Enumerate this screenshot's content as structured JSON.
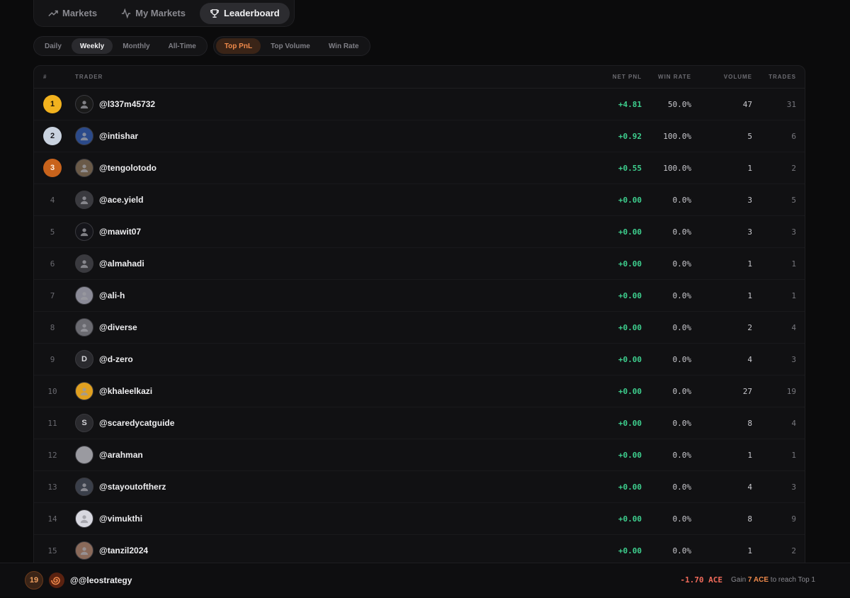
{
  "nav": {
    "tabs": [
      {
        "label": "Markets",
        "icon": "trend-icon"
      },
      {
        "label": "My Markets",
        "icon": "activity-icon"
      },
      {
        "label": "Leaderboard",
        "icon": "trophy-icon"
      }
    ],
    "active": "Leaderboard"
  },
  "period_filters": [
    "Daily",
    "Weekly",
    "Monthly",
    "All-Time"
  ],
  "period_active": "Weekly",
  "sort_filters": [
    "Top PnL",
    "Top Volume",
    "Win Rate"
  ],
  "sort_active": "Top PnL",
  "table": {
    "headers": {
      "rank": "#",
      "trader": "TRADER",
      "pnl": "NET PNL",
      "win": "WIN RATE",
      "volume": "VOLUME",
      "trades": "TRADES"
    },
    "rows": [
      {
        "rank": "1",
        "handle": "@l337m45732",
        "pnl": "+4.81",
        "win": "50.0%",
        "volume": "47",
        "trades": "31",
        "avatar": "",
        "avatar_color": "#1a1a1a"
      },
      {
        "rank": "2",
        "handle": "@intishar",
        "pnl": "+0.92",
        "win": "100.0%",
        "volume": "5",
        "trades": "6",
        "avatar": "",
        "avatar_color": "#2b4a8a"
      },
      {
        "rank": "3",
        "handle": "@tengolotodo",
        "pnl": "+0.55",
        "win": "100.0%",
        "volume": "1",
        "trades": "2",
        "avatar": "",
        "avatar_color": "#6a5a48"
      },
      {
        "rank": "4",
        "handle": "@ace.yield",
        "pnl": "+0.00",
        "win": "0.0%",
        "volume": "3",
        "trades": "5",
        "avatar": "",
        "avatar_color": "#3a3a3f"
      },
      {
        "rank": "5",
        "handle": "@mawit07",
        "pnl": "+0.00",
        "win": "0.0%",
        "volume": "3",
        "trades": "3",
        "avatar": "",
        "avatar_color": "#15151a"
      },
      {
        "rank": "6",
        "handle": "@almahadi",
        "pnl": "+0.00",
        "win": "0.0%",
        "volume": "1",
        "trades": "1",
        "avatar": "",
        "avatar_color": "#3a3a3f"
      },
      {
        "rank": "7",
        "handle": "@ali-h",
        "pnl": "+0.00",
        "win": "0.0%",
        "volume": "1",
        "trades": "1",
        "avatar": "",
        "avatar_color": "#8a8a96"
      },
      {
        "rank": "8",
        "handle": "@diverse",
        "pnl": "+0.00",
        "win": "0.0%",
        "volume": "2",
        "trades": "4",
        "avatar": "",
        "avatar_color": "#6a6a70"
      },
      {
        "rank": "9",
        "handle": "@d-zero",
        "pnl": "+0.00",
        "win": "0.0%",
        "volume": "4",
        "trades": "3",
        "avatar": "D",
        "avatar_color": "#2a2a2e"
      },
      {
        "rank": "10",
        "handle": "@khaleelkazi",
        "pnl": "+0.00",
        "win": "0.0%",
        "volume": "27",
        "trades": "19",
        "avatar": "",
        "avatar_color": "#e0a020"
      },
      {
        "rank": "11",
        "handle": "@scaredycatguide",
        "pnl": "+0.00",
        "win": "0.0%",
        "volume": "8",
        "trades": "4",
        "avatar": "S",
        "avatar_color": "#2a2a2e"
      },
      {
        "rank": "12",
        "handle": "@arahman",
        "pnl": "+0.00",
        "win": "0.0%",
        "volume": "1",
        "trades": "1",
        "avatar": "",
        "avatar_color": "#9a9aa0"
      },
      {
        "rank": "13",
        "handle": "@stayoutoftherz",
        "pnl": "+0.00",
        "win": "0.0%",
        "volume": "4",
        "trades": "3",
        "avatar": "",
        "avatar_color": "#3a3f4a"
      },
      {
        "rank": "14",
        "handle": "@vimukthi",
        "pnl": "+0.00",
        "win": "0.0%",
        "volume": "8",
        "trades": "9",
        "avatar": "",
        "avatar_color": "#d8d8e0"
      },
      {
        "rank": "15",
        "handle": "@tanzil2024",
        "pnl": "+0.00",
        "win": "0.0%",
        "volume": "1",
        "trades": "2",
        "avatar": "",
        "avatar_color": "#8a6a5a"
      }
    ]
  },
  "medal_colors": {
    "1": "#f2b21e",
    "2": "#c9d2df",
    "3": "#c8631c"
  },
  "me": {
    "rank": "19",
    "handle": "@@leostrategy",
    "pnl": "-1.70 ACE",
    "gain_prefix": "Gain",
    "gain_amount": "7 ACE",
    "gain_suffix": "to reach Top 1"
  }
}
